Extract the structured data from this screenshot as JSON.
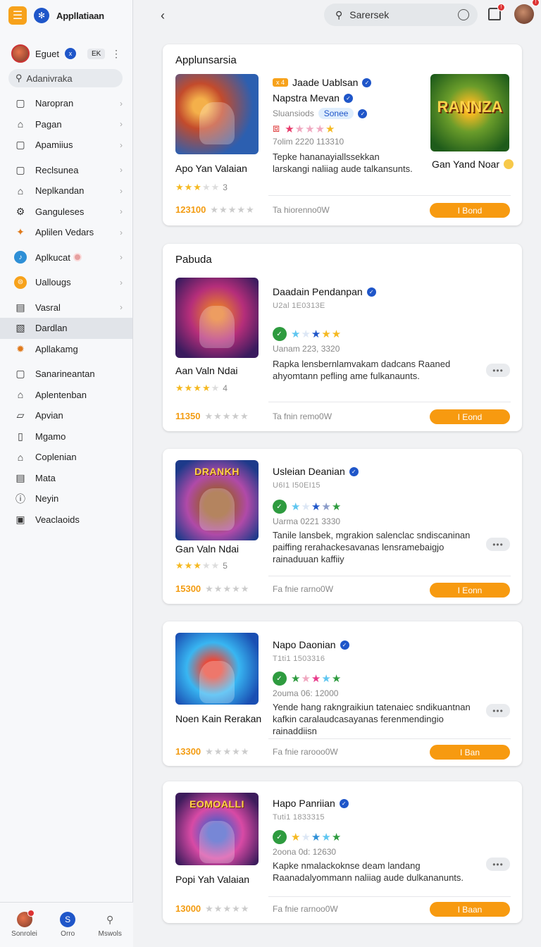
{
  "sidebar": {
    "app_name": "Appllatiaan",
    "user": {
      "name": "Eguet",
      "badge": "x",
      "lang": "EK"
    },
    "search_placeholder": "Adanivraka",
    "items": [
      {
        "label": "Naropran",
        "icon": "window-icon"
      },
      {
        "label": "Pagan",
        "icon": "tag-icon"
      },
      {
        "label": "Apamiius",
        "icon": "window-icon"
      },
      {
        "label": "Reclsunea",
        "icon": "window-icon"
      },
      {
        "label": "Neplkandan",
        "icon": "tag-icon"
      },
      {
        "label": "Ganguleses",
        "icon": "gear-icon"
      },
      {
        "label": "Aplilen Vedars",
        "icon": "game-icon"
      },
      {
        "label": "Aplkucat",
        "icon": "app-store-icon"
      },
      {
        "label": "Uallougs",
        "icon": "coin-icon"
      },
      {
        "label": "Vasral",
        "icon": "window-icon"
      },
      {
        "label": "Dardlan",
        "icon": "bookmark-icon"
      },
      {
        "label": "Apllakamg",
        "icon": "settings-icon"
      },
      {
        "label": "Sanarineantan",
        "icon": "window-icon"
      },
      {
        "label": "Aplentenban",
        "icon": "tag-icon"
      },
      {
        "label": "Apvian",
        "icon": "bookmark-icon"
      },
      {
        "label": "Mgamo",
        "icon": "bookmark-icon"
      },
      {
        "label": "Coplenian",
        "icon": "tag-icon"
      },
      {
        "label": "Mata",
        "icon": "bookmark-icon"
      },
      {
        "label": "Neyin",
        "icon": "info-icon"
      },
      {
        "label": "Veaclaoids",
        "icon": "window-icon"
      }
    ],
    "bottom_tabs": [
      {
        "label": "Sonrolei"
      },
      {
        "label": "Orro"
      },
      {
        "label": "Mswols"
      }
    ]
  },
  "topbar": {
    "search_text": "Sarersek"
  },
  "cards": [
    {
      "title": "Applunsarsia",
      "thumb_text": "",
      "game_name": "Apo Yan Valaian",
      "star_count": "3",
      "price": "123100",
      "version": "Ta hiorenno0W",
      "get_label": "I Bond",
      "right": {
        "tag": "x 4",
        "title1": "Jaade Uablsan",
        "title2": "Napstra Mevan",
        "category_label": "Sluansiods",
        "category_pill": "Sonee",
        "date": "7olim 2220 113310",
        "desc": "Tepke hananayiallssekkan larskangi naliiag aude talkansunts.",
        "game_thumb_text": "RANNZA",
        "game_name": "Gan Yand Noar"
      }
    },
    {
      "title": "Pabuda",
      "game_name": "Aan Valn Ndai",
      "star_count": "4",
      "price": "11350",
      "version": "Ta fnin remo0W",
      "get_label": "I Eond",
      "rtitle": "Daadain Pendanpan",
      "sub": "U2al 1E0313E",
      "date": "Uanam 223, 3320",
      "desc": "Rapka lensbernlamvakam dadcans Raaned ahyomtann pefling ame fulkanaunts."
    },
    {
      "title": "",
      "thumb_text": "DRANKH",
      "game_name": "Gan Valn Ndai",
      "star_count": "5",
      "price": "15300",
      "version": "Fa fnie rarno0W",
      "get_label": "I Eonn",
      "rtitle": "Usleian Deanian",
      "sub": "U6I1 I50EI15",
      "date": "Uarma 0221 3330",
      "desc": "Tanile lansbek, mgrakion salenclac sndiscaninan paiffing rerahackesavanas lensramebaigjo rainaduuan kaffiiy"
    },
    {
      "title": "",
      "game_name": "Noen Kain Rerakan",
      "price": "13300",
      "version": "Fa fnie rarooo0W",
      "get_label": "I Ban",
      "rtitle": "Napo Daonian",
      "sub": "T1ti1 1503316",
      "date": "2ouma 06: 12000",
      "desc": "Yende hang rakngraikiun tatenaiec sndikuantnan kafkin caralaudcasayanas ferenmendingio rainaddiisn"
    },
    {
      "title": "",
      "thumb_text": "EOMOALLI",
      "game_name": "Popi Yah Valaian",
      "price": "13000",
      "version": "Fa fnie rarnoo0W",
      "get_label": "I Baan",
      "rtitle": "Hapo Panriian",
      "sub": "Tuti1 1833315",
      "date": "2oona 0d: 12630",
      "desc": "Kapke nmalackoknse deam landang Raanadalyommann naliiag aude dulkananunts."
    }
  ]
}
